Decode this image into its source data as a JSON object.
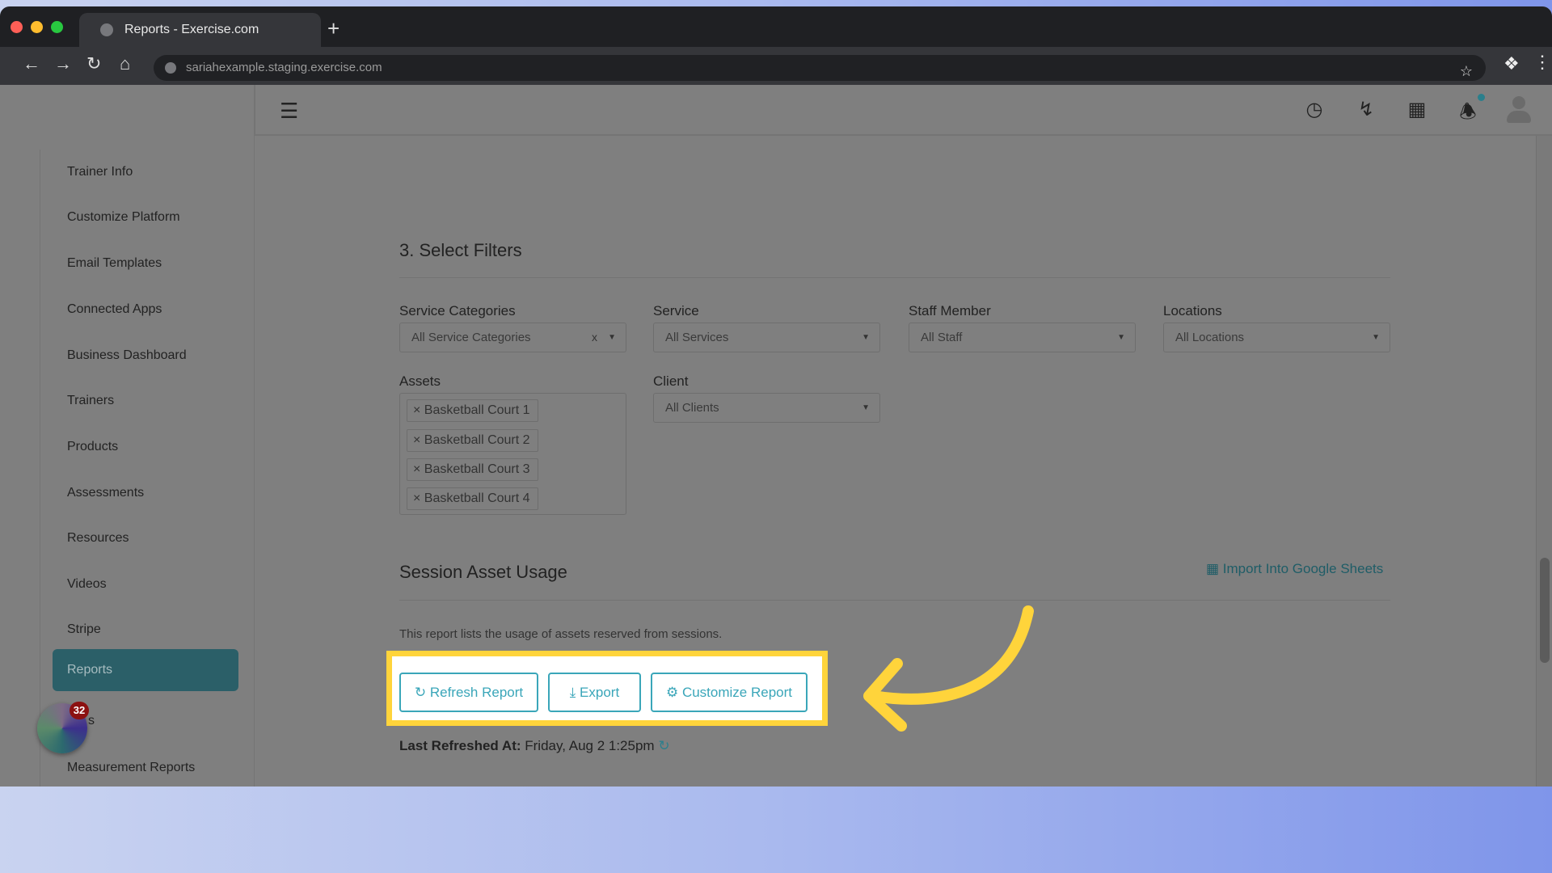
{
  "browser": {
    "tab_title": "Reports - Exercise.com",
    "url": "sariahexample.staging.exercise.com",
    "new_tab": "+"
  },
  "header": {
    "icons": [
      "clock-icon",
      "bolt-icon",
      "grid-icon",
      "bell-icon",
      "avatar-icon"
    ],
    "notification_dot_color": "#2a7f8c"
  },
  "sidebar": {
    "items": [
      {
        "label": "Trainer Info"
      },
      {
        "label": "Customize Platform"
      },
      {
        "label": "Email Templates"
      },
      {
        "label": "Connected Apps"
      },
      {
        "label": "Business Dashboard"
      },
      {
        "label": "Trainers"
      },
      {
        "label": "Products"
      },
      {
        "label": "Assessments"
      },
      {
        "label": "Resources"
      },
      {
        "label": "Videos"
      },
      {
        "label": "Stripe"
      },
      {
        "label": "Reports",
        "active": true
      },
      {
        "label": "s"
      },
      {
        "label": "Measurement Reports"
      }
    ],
    "badge_count": "32"
  },
  "filters": {
    "title": "3. Select Filters",
    "service_categories": {
      "label": "Service Categories",
      "value": "All Service Categories",
      "clear": "x"
    },
    "service": {
      "label": "Service",
      "value": "All Services"
    },
    "staff": {
      "label": "Staff Member",
      "value": "All Staff"
    },
    "locations": {
      "label": "Locations",
      "value": "All Locations"
    },
    "assets": {
      "label": "Assets",
      "tags": [
        "Basketball Court 1",
        "Basketball Court 2",
        "Basketball Court 3",
        "Basketball Court 4"
      ]
    },
    "client": {
      "label": "Client",
      "value": "All Clients"
    }
  },
  "report": {
    "title": "Session Asset Usage",
    "import_link": "Import Into Google Sheets",
    "description": "This report lists the usage of assets reserved from sessions.",
    "buttons": {
      "refresh": "Refresh Report",
      "export": "Export",
      "customize": "Customize Report"
    },
    "last_refreshed_label": "Last Refreshed At:",
    "last_refreshed_value": "Friday, Aug 2 1:25pm"
  },
  "colors": {
    "accent": "#3aa6b9",
    "highlight": "#ffd43b",
    "active_nav": "#2b5f68"
  }
}
